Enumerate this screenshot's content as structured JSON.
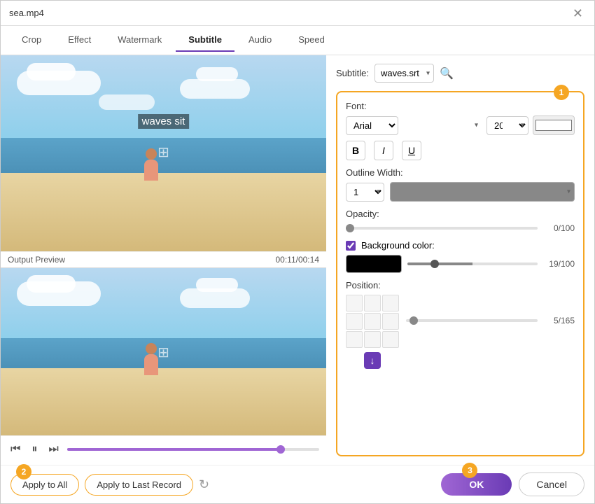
{
  "window": {
    "title": "sea.mp4",
    "close_label": "✕"
  },
  "tabs": {
    "items": [
      {
        "id": "crop",
        "label": "Crop"
      },
      {
        "id": "effect",
        "label": "Effect"
      },
      {
        "id": "watermark",
        "label": "Watermark"
      },
      {
        "id": "subtitle",
        "label": "Subtitle"
      },
      {
        "id": "audio",
        "label": "Audio"
      },
      {
        "id": "speed",
        "label": "Speed"
      }
    ],
    "active": "subtitle"
  },
  "preview": {
    "output_label": "Output Preview",
    "time": "00:11/00:14",
    "subtitle_text": "waves sit"
  },
  "subtitle": {
    "label": "Subtitle:",
    "value": "waves.srt",
    "options": [
      "waves.srt"
    ]
  },
  "font": {
    "label": "Font:",
    "family": "Arial",
    "size": "20",
    "bold_label": "B",
    "italic_label": "I",
    "underline_label": "U"
  },
  "outline": {
    "label": "Outline Width:",
    "width": "1"
  },
  "opacity": {
    "label": "Opacity:",
    "value": "0/100"
  },
  "background": {
    "label": "Background color:",
    "checked": true,
    "value": "19/100"
  },
  "position": {
    "label": "Position:",
    "slider_value": "5/165"
  },
  "actions": {
    "apply_all": "Apply to All",
    "apply_last": "Apply to Last Record",
    "ok": "OK",
    "cancel": "Cancel"
  },
  "badges": {
    "b1": "1",
    "b2": "2",
    "b3": "3"
  }
}
